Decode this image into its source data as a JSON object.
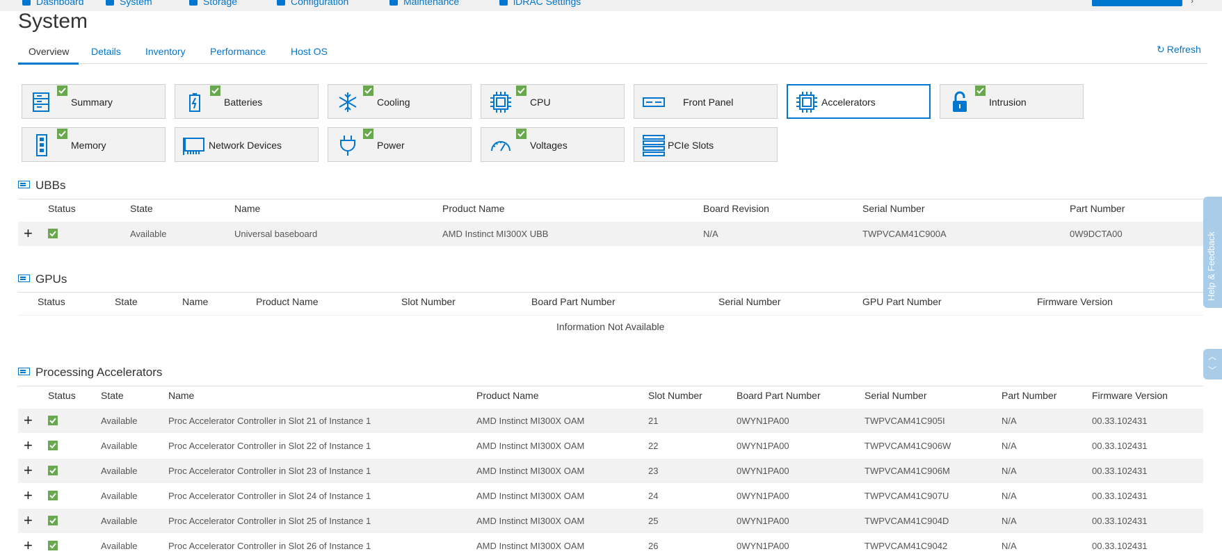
{
  "colors": {
    "accent": "#0076ce",
    "status_ok": "#6aa84f"
  },
  "topnav": {
    "items": [
      {
        "label": "Dashboard",
        "icon": "home-icon"
      },
      {
        "label": "System",
        "icon": "system-icon"
      },
      {
        "label": "Storage",
        "icon": "storage-icon"
      },
      {
        "label": "Configuration",
        "icon": "configuration-icon"
      },
      {
        "label": "Maintenance",
        "icon": "maintenance-icon"
      },
      {
        "label": "iDRAC Settings",
        "icon": "idrac-settings-icon"
      }
    ]
  },
  "page": {
    "title": "System"
  },
  "tabs": [
    "Overview",
    "Details",
    "Inventory",
    "Performance",
    "Host OS"
  ],
  "refresh_label": "Refresh",
  "tiles": [
    {
      "label": "Summary",
      "icon": "summary-icon",
      "ok": true
    },
    {
      "label": "Batteries",
      "icon": "battery-icon",
      "ok": true
    },
    {
      "label": "Cooling",
      "icon": "snowflake-icon",
      "ok": true
    },
    {
      "label": "CPU",
      "icon": "cpu-chip-icon",
      "ok": true
    },
    {
      "label": "Front Panel",
      "icon": "front-panel-icon",
      "ok": false
    },
    {
      "label": "Accelerators",
      "icon": "accelerator-chip-icon",
      "ok": false,
      "selected": true
    },
    {
      "label": "Intrusion",
      "icon": "padlock-icon",
      "ok": true
    },
    {
      "label": "Memory",
      "icon": "memory-module-icon",
      "ok": true
    },
    {
      "label": "Network Devices",
      "icon": "network-card-icon",
      "ok": false
    },
    {
      "label": "Power",
      "icon": "power-plug-icon",
      "ok": true
    },
    {
      "label": "Voltages",
      "icon": "gauge-icon",
      "ok": true
    },
    {
      "label": "PCIe Slots",
      "icon": "pcie-slots-icon",
      "ok": false
    }
  ],
  "ubbs": {
    "title": "UBBs",
    "headers": [
      "Status",
      "State",
      "Name",
      "Product Name",
      "Board Revision",
      "Serial Number",
      "Part Number"
    ],
    "rows": [
      {
        "state": "Available",
        "name": "Universal baseboard",
        "product": "AMD Instinct MI300X UBB",
        "revision": "N/A",
        "serial": "TWPVCAM41C900A",
        "part": "0W9DCTA00"
      }
    ]
  },
  "gpus": {
    "title": "GPUs",
    "headers": [
      "Status",
      "State",
      "Name",
      "Product Name",
      "Slot Number",
      "Board Part Number",
      "Serial Number",
      "GPU Part Number",
      "Firmware Version"
    ],
    "empty_message": "Information Not Available"
  },
  "accelerators": {
    "title": "Processing Accelerators",
    "headers": [
      "Status",
      "State",
      "Name",
      "Product Name",
      "Slot Number",
      "Board Part Number",
      "Serial Number",
      "Part Number",
      "Firmware Version"
    ],
    "rows": [
      {
        "state": "Available",
        "name": "Proc Accelerator Controller in Slot 21 of Instance 1",
        "product": "AMD Instinct MI300X OAM",
        "slot": "21",
        "board_part": "0WYN1PA00",
        "serial": "TWPVCAM41C905I",
        "part": "N/A",
        "firmware": "00.33.102431"
      },
      {
        "state": "Available",
        "name": "Proc Accelerator Controller in Slot 22 of Instance 1",
        "product": "AMD Instinct MI300X OAM",
        "slot": "22",
        "board_part": "0WYN1PA00",
        "serial": "TWPVCAM41C906W",
        "part": "N/A",
        "firmware": "00.33.102431"
      },
      {
        "state": "Available",
        "name": "Proc Accelerator Controller in Slot 23 of Instance 1",
        "product": "AMD Instinct MI300X OAM",
        "slot": "23",
        "board_part": "0WYN1PA00",
        "serial": "TWPVCAM41C906M",
        "part": "N/A",
        "firmware": "00.33.102431"
      },
      {
        "state": "Available",
        "name": "Proc Accelerator Controller in Slot 24 of Instance 1",
        "product": "AMD Instinct MI300X OAM",
        "slot": "24",
        "board_part": "0WYN1PA00",
        "serial": "TWPVCAM41C907U",
        "part": "N/A",
        "firmware": "00.33.102431"
      },
      {
        "state": "Available",
        "name": "Proc Accelerator Controller in Slot 25 of Instance 1",
        "product": "AMD Instinct MI300X OAM",
        "slot": "25",
        "board_part": "0WYN1PA00",
        "serial": "TWPVCAM41C904D",
        "part": "N/A",
        "firmware": "00.33.102431"
      },
      {
        "state": "Available",
        "name": "Proc Accelerator Controller in Slot 26 of Instance 1",
        "product": "AMD Instinct MI300X OAM",
        "slot": "26",
        "board_part": "0WYN1PA00",
        "serial": "TWPVCAM41C9042",
        "part": "N/A",
        "firmware": "00.33.102431"
      }
    ]
  },
  "help_feedback": "Help & Feedback",
  "scroll": {
    "up": "︿",
    "down": "﹀"
  }
}
